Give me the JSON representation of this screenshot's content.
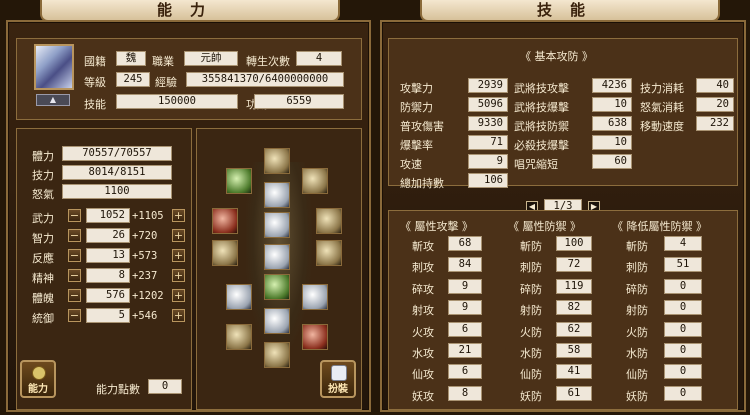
{
  "left": {
    "title": "能力",
    "profile": {
      "nation_label": "國籍",
      "nation": "魏",
      "job_label": "職業",
      "job": "元帥",
      "rebirth_label": "轉生次數",
      "rebirth": "4",
      "level_label": "等級",
      "level": "245",
      "exp_label": "經驗",
      "exp": "355841370/6400000000",
      "skill_label": "技能",
      "skill": "150000",
      "merit_label": "功勳",
      "merit": "6559"
    },
    "vitals": [
      {
        "label": "體力",
        "value": "70557/70557"
      },
      {
        "label": "技力",
        "value": "8014/8151"
      },
      {
        "label": "怒氣",
        "value": "1100"
      }
    ],
    "attributes": [
      {
        "label": "武力",
        "value": "1052",
        "bonus": "+1105"
      },
      {
        "label": "智力",
        "value": "26",
        "bonus": "+720"
      },
      {
        "label": "反應",
        "value": "13",
        "bonus": "+573"
      },
      {
        "label": "精神",
        "value": "8",
        "bonus": "+237"
      },
      {
        "label": "體魄",
        "value": "576",
        "bonus": "+1202"
      },
      {
        "label": "統御",
        "value": "5",
        "bonus": "+546"
      }
    ],
    "points_label": "能力點數",
    "points": "0",
    "ability_button": "能力",
    "costume_button": "扮裝"
  },
  "right": {
    "title": "技能",
    "basic_header": "《 基本攻防 》",
    "basic": [
      [
        "攻擊力",
        "2939",
        "武將技攻擊",
        "4236",
        "技力消耗",
        "40"
      ],
      [
        "防禦力",
        "5096",
        "武將技爆擊",
        "10",
        "怒氣消耗",
        "20"
      ],
      [
        "普攻傷害",
        "9330",
        "武將技防禦",
        "638",
        "移動速度",
        "232"
      ],
      [
        "爆擊率",
        "71",
        "必殺技爆擊",
        "10",
        "",
        ""
      ],
      [
        "攻速",
        "9",
        "唱咒縮短",
        "60",
        "",
        ""
      ],
      [
        "總加持數",
        "106",
        "",
        "",
        "",
        ""
      ]
    ],
    "page": "1/3",
    "attr_attack_header": "《 屬性攻擊 》",
    "attr_defense_header": "《 屬性防禦 》",
    "attr_reduce_header": "《 降低屬性防禦 》",
    "attr_rows": [
      [
        "斬攻",
        "68",
        "斬防",
        "100",
        "斬防",
        "4"
      ],
      [
        "刺攻",
        "84",
        "刺防",
        "72",
        "刺防",
        "51"
      ],
      [
        "碎攻",
        "9",
        "碎防",
        "119",
        "碎防",
        "0"
      ],
      [
        "射攻",
        "9",
        "射防",
        "82",
        "射防",
        "0"
      ],
      [
        "火攻",
        "6",
        "火防",
        "62",
        "火防",
        "0"
      ],
      [
        "水攻",
        "21",
        "水防",
        "58",
        "水防",
        "0"
      ],
      [
        "仙攻",
        "6",
        "仙防",
        "41",
        "仙防",
        "0"
      ],
      [
        "妖攻",
        "8",
        "妖防",
        "61",
        "妖防",
        "0"
      ]
    ]
  }
}
